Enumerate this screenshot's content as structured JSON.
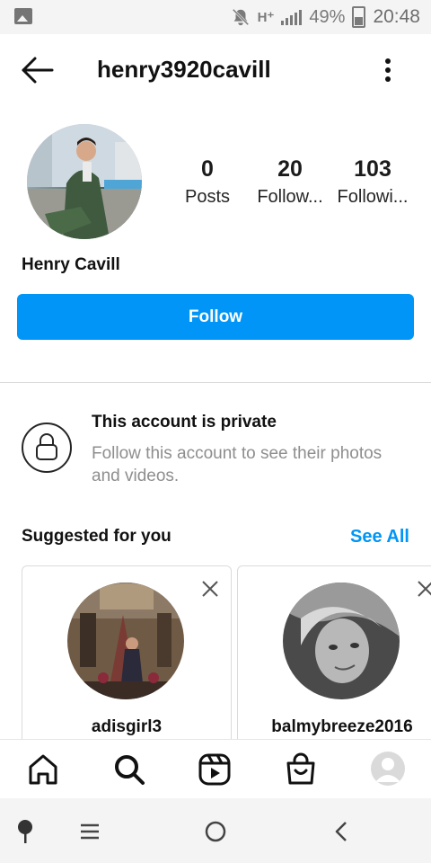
{
  "status_bar": {
    "network": "H⁺",
    "battery": "49%",
    "time": "20:48",
    "icons": [
      "image-icon",
      "bell-off-icon",
      "signal-icon",
      "battery-icon"
    ]
  },
  "header": {
    "username": "henry3920cavill",
    "back_icon": "arrow-left-icon",
    "more_icon": "more-vertical-icon"
  },
  "profile": {
    "full_name": "Henry Cavill",
    "stats": [
      {
        "value": "0",
        "label": "Posts"
      },
      {
        "value": "20",
        "label": "Follow..."
      },
      {
        "value": "103",
        "label": "Followi..."
      }
    ],
    "follow_label": "Follow"
  },
  "private_notice": {
    "title": "This account is private",
    "subtitle": "Follow this account to see their photos and videos.",
    "icon": "lock-icon"
  },
  "suggested": {
    "title": "Suggested for you",
    "see_all": "See All",
    "cards": [
      {
        "username": "adisgirl3"
      },
      {
        "username": "balmybreeze2016"
      }
    ]
  },
  "bottom_nav": {
    "items": [
      "home-icon",
      "search-icon",
      "reels-icon",
      "shop-icon",
      "profile-avatar"
    ]
  },
  "system_nav": {
    "items": [
      "assistant-icon",
      "recents-icon",
      "home-circle-icon",
      "back-chevron-icon"
    ]
  },
  "colors": {
    "accent": "#0095f6",
    "text": "#262626",
    "secondary": "#8e8e8e",
    "divider": "#dbdbdb"
  }
}
